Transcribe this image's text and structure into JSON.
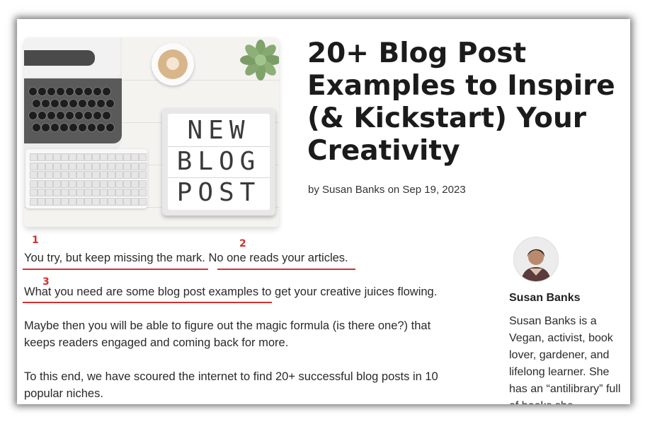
{
  "hero": {
    "lightbox_lines": [
      "NEW",
      "BLOG",
      "POST"
    ]
  },
  "article": {
    "title": "20+ Blog Post Examples to Inspire (& Kickstart) Your Creativity",
    "byline": "by Susan Banks on Sep 19, 2023",
    "paragraphs": [
      "You try, but keep missing the mark. No one reads your articles.",
      "What you need are some blog post examples to get your creative juices flowing.",
      "Maybe then you will be able to figure out the magic formula (is there one?) that keeps readers engaged and coming back for more.",
      "To this end, we have scoured the internet to find 20+ successful blog posts in 10 popular niches."
    ]
  },
  "annotations": {
    "markers": [
      "1",
      "2",
      "3"
    ],
    "color": "#d32f2f"
  },
  "author": {
    "name": "Susan Banks",
    "bio": "Susan Banks is a Vegan, activist, book lover, gardener, and lifelong learner. She has an “antilibrary” full of books she"
  }
}
